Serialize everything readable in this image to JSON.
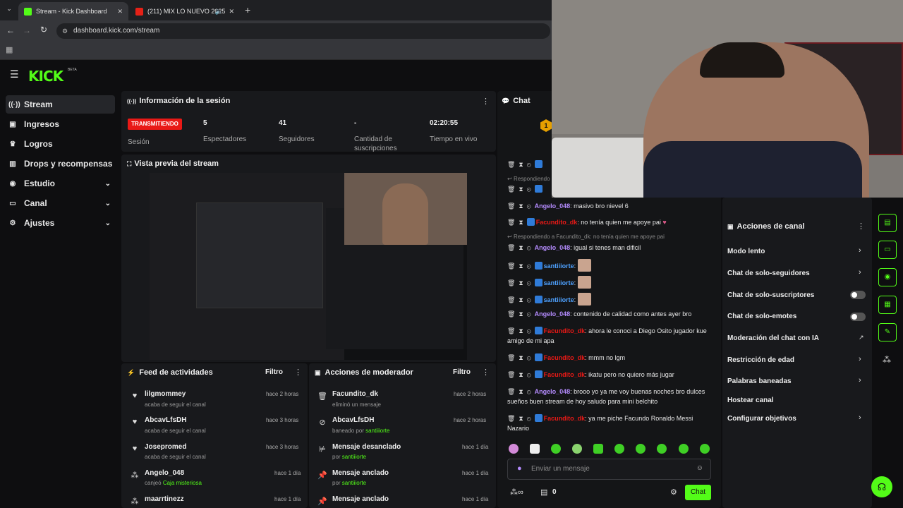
{
  "browser": {
    "tabs": [
      {
        "title": "Stream - Kick Dashboard",
        "active": true
      },
      {
        "title": "(211) MIX LO NUEVO 2025",
        "active": false
      }
    ],
    "url": "dashboard.kick.com/stream"
  },
  "brand": {
    "logo": "KICK",
    "beta": "BETA",
    "accent": "#53fc18",
    "live_color": "#e91916"
  },
  "sidebar": {
    "items": [
      {
        "label": "Stream",
        "icon": "broadcast-icon",
        "active": true
      },
      {
        "label": "Ingresos",
        "icon": "revenue-icon"
      },
      {
        "label": "Logros",
        "icon": "trophy-icon"
      },
      {
        "label": "Drops y recompensas",
        "icon": "drops-icon"
      },
      {
        "label": "Estudio",
        "icon": "studio-icon",
        "expandable": true
      },
      {
        "label": "Canal",
        "icon": "channel-icon",
        "expandable": true
      },
      {
        "label": "Ajustes",
        "icon": "gear-icon",
        "expandable": true
      }
    ]
  },
  "session": {
    "title": "Información de la sesión",
    "status": "TRANSMITIENDO",
    "status_label": "Sesión",
    "stats": [
      {
        "value": "5",
        "label": "Espectadores"
      },
      {
        "value": "41",
        "label": "Seguidores"
      },
      {
        "value": "-",
        "label": "Cantidad de suscripciones"
      },
      {
        "value": "02:20:55",
        "label": "Tiempo en vivo"
      }
    ]
  },
  "preview": {
    "title": "Vista previa del stream"
  },
  "activity_feed": {
    "title": "Feed de actividades",
    "filter": "Filtro",
    "items": [
      {
        "name": "lilgmommey",
        "detail": "acaba de seguir el canal",
        "time": "hace 2 horas",
        "icon": "heart-icon"
      },
      {
        "name": "AbcavLfsDH",
        "detail": "acaba de seguir el canal",
        "time": "hace 3 horas",
        "icon": "heart-icon"
      },
      {
        "name": "Josepromed",
        "detail": "acaba de seguir el canal",
        "time": "hace 3 horas",
        "icon": "heart-icon"
      },
      {
        "name": "Angelo_048",
        "detail": "canjeó",
        "highlight": "Caja misteriosa",
        "time": "hace 1 día",
        "icon": "reward-icon"
      },
      {
        "name": "maarrtinezz",
        "detail": "",
        "time": "hace 1 día",
        "icon": "reward-icon"
      }
    ]
  },
  "mod_actions": {
    "title": "Acciones de moderador",
    "filter": "Filtro",
    "items": [
      {
        "name": "Facundito_dk",
        "detail": "eliminó un mensaje",
        "highlight": "",
        "time": "hace 2 horas",
        "icon": "trash-icon"
      },
      {
        "name": "AbcavLfsDH",
        "detail": "baneado por",
        "highlight": "santiiiorte",
        "time": "hace 2 horas",
        "icon": "ban-icon"
      },
      {
        "name": "Mensaje desanclado",
        "detail": "por",
        "highlight": "santiiiorte",
        "time": "hace 1 día",
        "icon": "unpin-icon"
      },
      {
        "name": "Mensaje anclado",
        "detail": "por",
        "highlight": "santiiiorte",
        "time": "hace 1 día",
        "icon": "pin-icon"
      },
      {
        "name": "Mensaje anclado",
        "detail": "",
        "highlight": "",
        "time": "hace 1 día",
        "icon": "pin-icon"
      }
    ]
  },
  "chat": {
    "title": "Chat",
    "reply_a": "Respondiendo",
    "reply_b": "Respondiendo a Facundito_dk: no tenía quien me apoye pai",
    "messages": [
      {
        "user": "Angelo_048",
        "color": "#b58cff",
        "text": "masivo bro nievel 6"
      },
      {
        "user": "Facundito_dk",
        "color": "#e91916",
        "text": "no tenía quien me apoye pai"
      },
      {
        "user": "Angelo_048",
        "color": "#b58cff",
        "text": "igual si tenes man dificil"
      },
      {
        "user": "santiiiorte",
        "color": "#4ea1ff",
        "text": ""
      },
      {
        "user": "santiiiorte",
        "color": "#4ea1ff",
        "text": ""
      },
      {
        "user": "santiiiorte",
        "color": "#4ea1ff",
        "text": ""
      },
      {
        "user": "Angelo_048",
        "color": "#b58cff",
        "text": "contenido de calidad como antes ayer bro"
      },
      {
        "user": "Facundito_dk",
        "color": "#e91916",
        "text": "ahora le conoci a Diego Osito jugador kue amigo de mi apa"
      },
      {
        "user": "Facundito_dk",
        "color": "#e91916",
        "text": "mmm no lgm"
      },
      {
        "user": "Facundito_dk",
        "color": "#e91916",
        "text": "ikatu pero no quiero más jugar"
      },
      {
        "user": "Angelo_048",
        "color": "#b58cff",
        "text": "brooo yo ya me voy buenas noches bro dulces sueños buen stream de hoy saludo para mini belchito"
      },
      {
        "user": "Facundito_dk",
        "color": "#e91916",
        "text": "ya me piche Facundo Ronaldo Messi Nazario"
      }
    ],
    "input_placeholder": "Enviar un mensaje",
    "points": "0",
    "send_label": "Chat"
  },
  "channel_actions": {
    "title": "Acciones de canal",
    "items": [
      {
        "label": "Modo lento",
        "control": "chevron"
      },
      {
        "label": "Chat de solo-seguidores",
        "control": "chevron"
      },
      {
        "label": "Chat de solo-suscriptores",
        "control": "toggle",
        "on": false
      },
      {
        "label": "Chat de solo-emotes",
        "control": "toggle",
        "on": false
      },
      {
        "label": "Moderación del chat con IA",
        "control": "external"
      },
      {
        "label": "Restricción de edad",
        "control": "chevron"
      },
      {
        "label": "Palabras baneadas",
        "control": "chevron"
      },
      {
        "label": "Hostear canal",
        "control": "none"
      },
      {
        "label": "Configurar objetivos",
        "control": "chevron"
      }
    ]
  }
}
